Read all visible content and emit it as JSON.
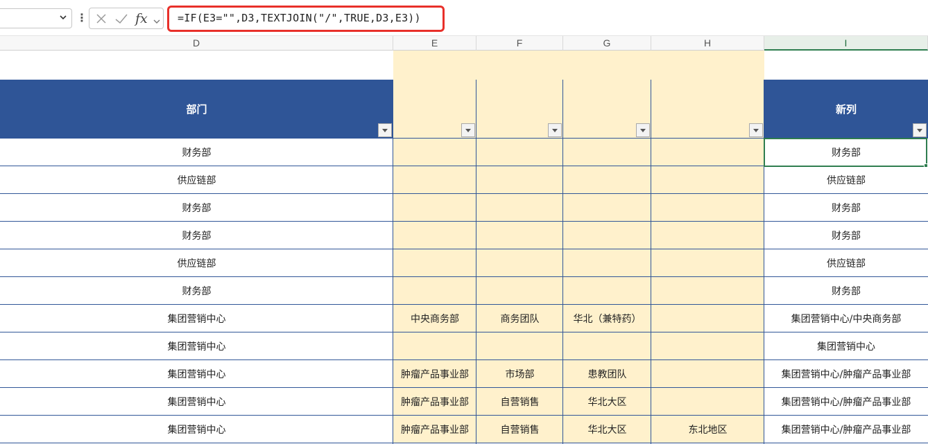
{
  "formula_bar": {
    "name_box_value": "",
    "fx_label": "fx",
    "formula": "=IF(E3=\"\",D3,TEXTJOIN(\"/\",TRUE,D3,E3))",
    "highlight_color": "#e8302a"
  },
  "columns": [
    "D",
    "E",
    "F",
    "G",
    "H",
    "I"
  ],
  "selected_column": "I",
  "header_row": {
    "d_label": "部门",
    "e_label": "",
    "f_label": "",
    "g_label": "",
    "h_label": "",
    "i_label": "新列"
  },
  "rows": [
    {
      "d": "财务部",
      "e": "",
      "f": "",
      "g": "",
      "h": "",
      "i": "财务部"
    },
    {
      "d": "供应链部",
      "e": "",
      "f": "",
      "g": "",
      "h": "",
      "i": "供应链部"
    },
    {
      "d": "财务部",
      "e": "",
      "f": "",
      "g": "",
      "h": "",
      "i": "财务部"
    },
    {
      "d": "财务部",
      "e": "",
      "f": "",
      "g": "",
      "h": "",
      "i": "财务部"
    },
    {
      "d": "供应链部",
      "e": "",
      "f": "",
      "g": "",
      "h": "",
      "i": "供应链部"
    },
    {
      "d": "财务部",
      "e": "",
      "f": "",
      "g": "",
      "h": "",
      "i": "财务部"
    },
    {
      "d": "集团营销中心",
      "e": "中央商务部",
      "f": "商务团队",
      "g": "华北（兼特药）",
      "h": "",
      "i": "集团营销中心/中央商务部"
    },
    {
      "d": "集团营销中心",
      "e": "",
      "f": "",
      "g": "",
      "h": "",
      "i": "集团营销中心"
    },
    {
      "d": "集团营销中心",
      "e": "肿瘤产品事业部",
      "f": "市场部",
      "g": "患教团队",
      "h": "",
      "i": "集团营销中心/肿瘤产品事业部"
    },
    {
      "d": "集团营销中心",
      "e": "肿瘤产品事业部",
      "f": "自营销售",
      "g": "华北大区",
      "h": "",
      "i": "集团营销中心/肿瘤产品事业部"
    },
    {
      "d": "集团营销中心",
      "e": "肿瘤产品事业部",
      "f": "自营销售",
      "g": "华北大区",
      "h": "东北地区",
      "i": "集团营销中心/肿瘤产品事业部"
    }
  ],
  "colors": {
    "header_fill": "#2f5597",
    "header_text": "#ffffff",
    "yellow_fill": "#fff1cc",
    "selection": "#2e7d4f"
  }
}
